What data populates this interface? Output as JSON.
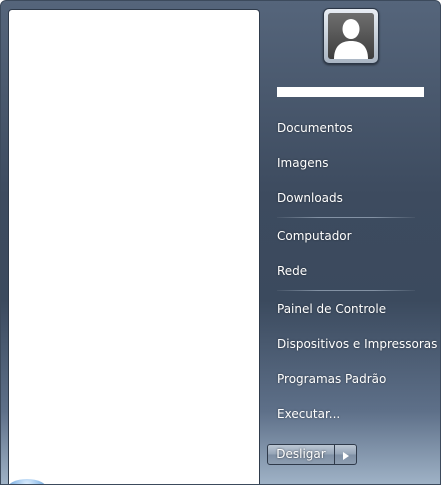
{
  "user": {
    "avatar_icon": "user-silhouette-icon"
  },
  "right_pane": {
    "items": [
      {
        "label": "Documentos"
      },
      {
        "label": "Imagens"
      },
      {
        "label": "Downloads"
      },
      {
        "label": "Computador"
      },
      {
        "label": "Rede"
      },
      {
        "label": "Painel de Controle"
      },
      {
        "label": "Dispositivos e Impressoras"
      },
      {
        "label": "Programas Padrão"
      },
      {
        "label": "Executar..."
      }
    ]
  },
  "shutdown": {
    "label": "Desligar",
    "arrow_icon": "triangle-right-icon"
  },
  "colors": {
    "menu_background": "#3d4b5f",
    "programs_pane": "#ffffff",
    "text": "#ffffff"
  }
}
